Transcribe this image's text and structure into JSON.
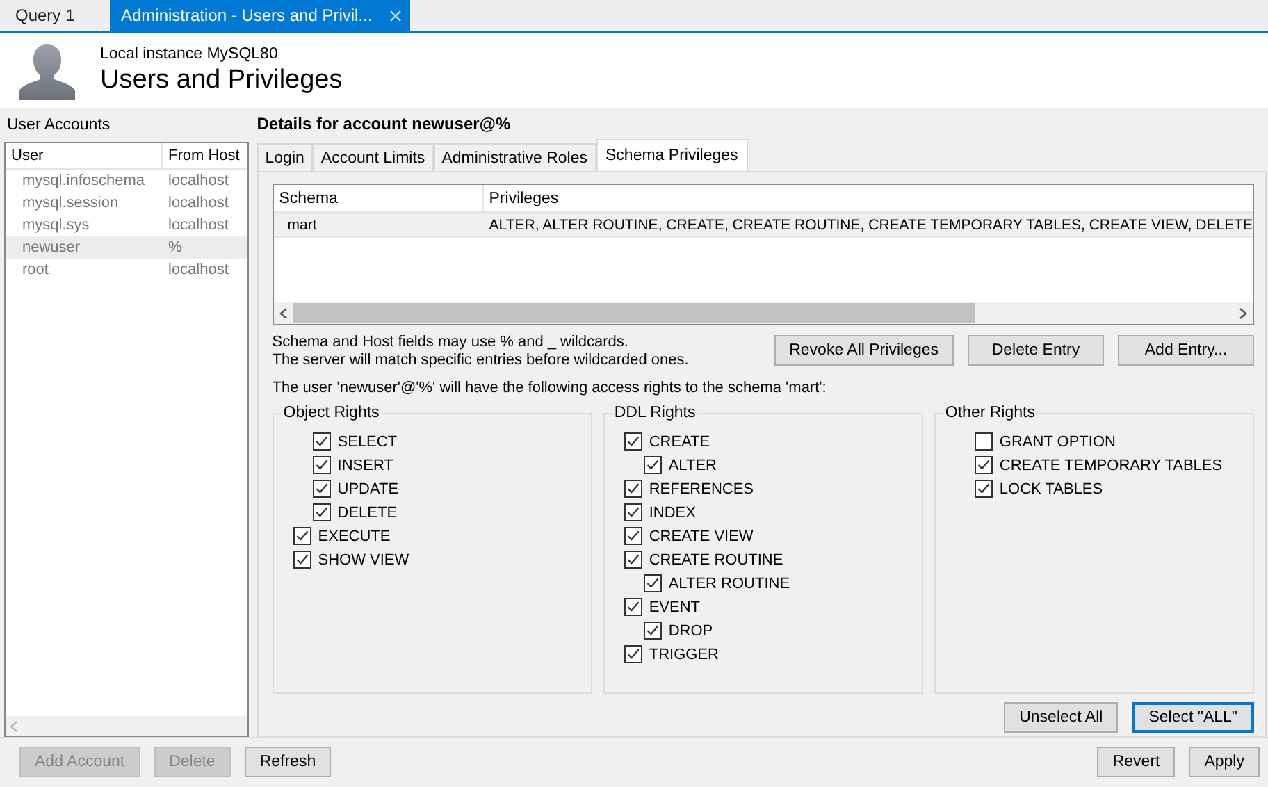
{
  "doc_tabs": [
    {
      "label": "Query 1",
      "selected": false,
      "closable": false
    },
    {
      "label": "Administration - Users and Privil...",
      "selected": true,
      "closable": true
    }
  ],
  "header": {
    "subtitle": "Local instance MySQL80",
    "title": "Users and Privileges"
  },
  "accounts": {
    "title": "User Accounts",
    "columns": [
      "User",
      "From Host"
    ],
    "rows": [
      {
        "user": "mysql.infoschema",
        "host": "localhost",
        "selected": false
      },
      {
        "user": "mysql.session",
        "host": "localhost",
        "selected": false
      },
      {
        "user": "mysql.sys",
        "host": "localhost",
        "selected": false
      },
      {
        "user": "newuser",
        "host": "%",
        "selected": true
      },
      {
        "user": "root",
        "host": "localhost",
        "selected": false
      }
    ]
  },
  "details": {
    "title": "Details for account newuser@%",
    "tabs": [
      {
        "label": "Login",
        "selected": false
      },
      {
        "label": "Account Limits",
        "selected": false
      },
      {
        "label": "Administrative Roles",
        "selected": false
      },
      {
        "label": "Schema Privileges",
        "selected": true
      }
    ],
    "schema_table": {
      "columns": [
        "Schema",
        "Privileges"
      ],
      "rows": [
        {
          "schema": "mart",
          "privileges": "ALTER, ALTER ROUTINE, CREATE, CREATE ROUTINE, CREATE TEMPORARY TABLES, CREATE VIEW, DELETE",
          "selected": true
        }
      ]
    },
    "hint_lines": [
      "Schema and Host fields may use % and _ wildcards.",
      "The server will match specific entries before wildcarded ones."
    ],
    "entry_buttons": [
      "Revoke All Privileges",
      "Delete Entry",
      "Add Entry..."
    ],
    "access_note": "The user 'newuser'@'%' will have the following access rights to the schema 'mart':",
    "groups": [
      {
        "title": "Object Rights",
        "items": [
          {
            "label": "SELECT",
            "checked": true,
            "kind": "indented"
          },
          {
            "label": "INSERT",
            "checked": true,
            "kind": "indented"
          },
          {
            "label": "UPDATE",
            "checked": true,
            "kind": "indented"
          },
          {
            "label": "DELETE",
            "checked": true,
            "kind": "indented"
          },
          {
            "label": "EXECUTE",
            "checked": true,
            "kind": "plain"
          },
          {
            "label": "SHOW VIEW",
            "checked": true,
            "kind": "plain"
          }
        ]
      },
      {
        "title": "DDL Rights",
        "items": [
          {
            "label": "CREATE",
            "checked": true,
            "kind": "plain"
          },
          {
            "label": "ALTER",
            "checked": true,
            "kind": "indented"
          },
          {
            "label": "REFERENCES",
            "checked": true,
            "kind": "plain"
          },
          {
            "label": "INDEX",
            "checked": true,
            "kind": "plain"
          },
          {
            "label": "CREATE VIEW",
            "checked": true,
            "kind": "plain"
          },
          {
            "label": "CREATE ROUTINE",
            "checked": true,
            "kind": "plain"
          },
          {
            "label": "ALTER ROUTINE",
            "checked": true,
            "kind": "indented"
          },
          {
            "label": "EVENT",
            "checked": true,
            "kind": "plain"
          },
          {
            "label": "DROP",
            "checked": true,
            "kind": "indented"
          },
          {
            "label": "TRIGGER",
            "checked": true,
            "kind": "plain"
          }
        ]
      },
      {
        "title": "Other Rights",
        "items": [
          {
            "label": "GRANT OPTION",
            "checked": false,
            "kind": "indented"
          },
          {
            "label": "CREATE TEMPORARY TABLES",
            "checked": true,
            "kind": "indented"
          },
          {
            "label": "LOCK TABLES",
            "checked": true,
            "kind": "indented"
          }
        ]
      }
    ],
    "select_buttons": [
      {
        "label": "Unselect All",
        "focused": false
      },
      {
        "label": "Select \"ALL\"",
        "focused": true
      }
    ]
  },
  "footer_left": [
    {
      "label": "Add Account",
      "disabled": true
    },
    {
      "label": "Delete",
      "disabled": true
    },
    {
      "label": "Refresh",
      "disabled": false
    }
  ],
  "footer_right": [
    {
      "label": "Revert",
      "disabled": false
    },
    {
      "label": "Apply",
      "disabled": false
    }
  ]
}
